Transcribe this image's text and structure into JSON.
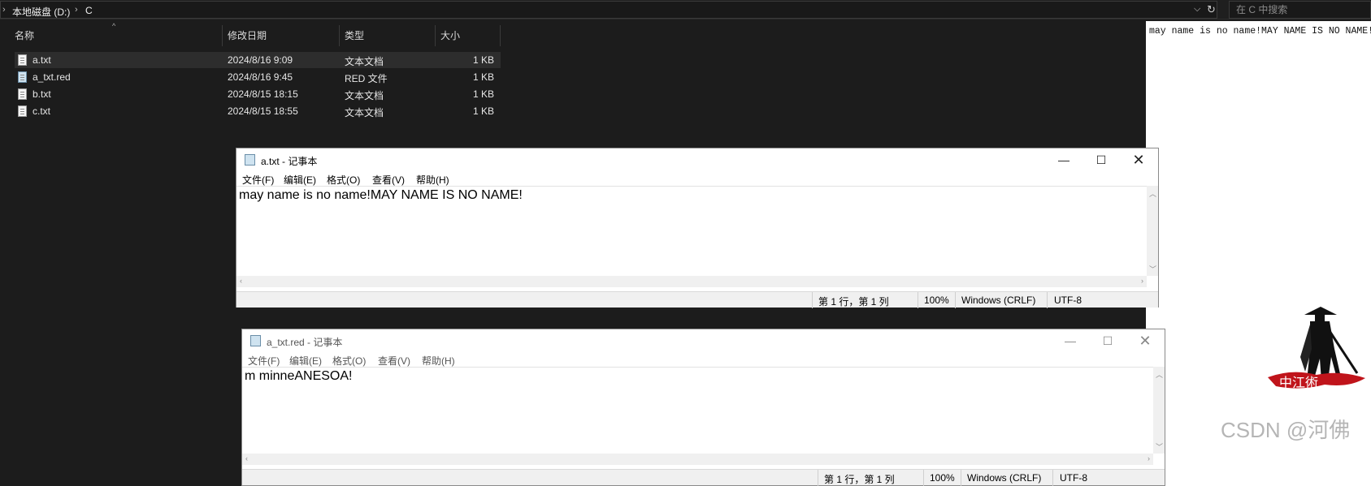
{
  "explorer": {
    "breadcrumb": [
      "本地磁盘 (D:)",
      "C"
    ],
    "search_placeholder": "在 C 中搜索",
    "columns": [
      "名称",
      "修改日期",
      "类型",
      "大小"
    ],
    "files": [
      {
        "name": "a.txt",
        "date": "2024/8/16 9:09",
        "type": "文本文档",
        "size": "1 KB",
        "icon": "text-file-icon"
      },
      {
        "name": "a_txt.red",
        "date": "2024/8/16 9:45",
        "type": "RED 文件",
        "size": "1 KB",
        "icon": "notepad-file-icon"
      },
      {
        "name": "b.txt",
        "date": "2024/8/15 18:15",
        "type": "文本文档",
        "size": "1 KB",
        "icon": "text-file-icon"
      },
      {
        "name": "c.txt",
        "date": "2024/8/15 18:55",
        "type": "文本文档",
        "size": "1 KB",
        "icon": "text-file-icon"
      }
    ]
  },
  "preview": {
    "text": "may name is no name!MAY NAME IS NO NAME!"
  },
  "notepad1": {
    "title": "a.txt - 记事本",
    "menu": [
      "文件(F)",
      "编辑(E)",
      "格式(O)",
      "查看(V)",
      "帮助(H)"
    ],
    "content": "may name is no name!MAY NAME IS NO NAME!",
    "status": {
      "position": "第 1 行，第 1 列",
      "zoom": "100%",
      "eol": "Windows (CRLF)",
      "encoding": "UTF-8"
    }
  },
  "notepad2": {
    "title": "a_txt.red - 记事本",
    "menu": [
      "文件(F)",
      "编辑(E)",
      "格式(O)",
      "查看(V)",
      "帮助(H)"
    ],
    "content": "m minneANESOA!",
    "status": {
      "position": "第 1 行，第 1 列",
      "zoom": "100%",
      "eol": "Windows (CRLF)",
      "encoding": "UTF-8"
    }
  },
  "watermark": "CSDN @河佛",
  "logo_text": "中江術",
  "colors": {
    "explorer_bg": "#1c1c1c",
    "selected_row": "#2d2d2d",
    "window_bg": "#ffffff",
    "logo_red": "#c0141b"
  }
}
